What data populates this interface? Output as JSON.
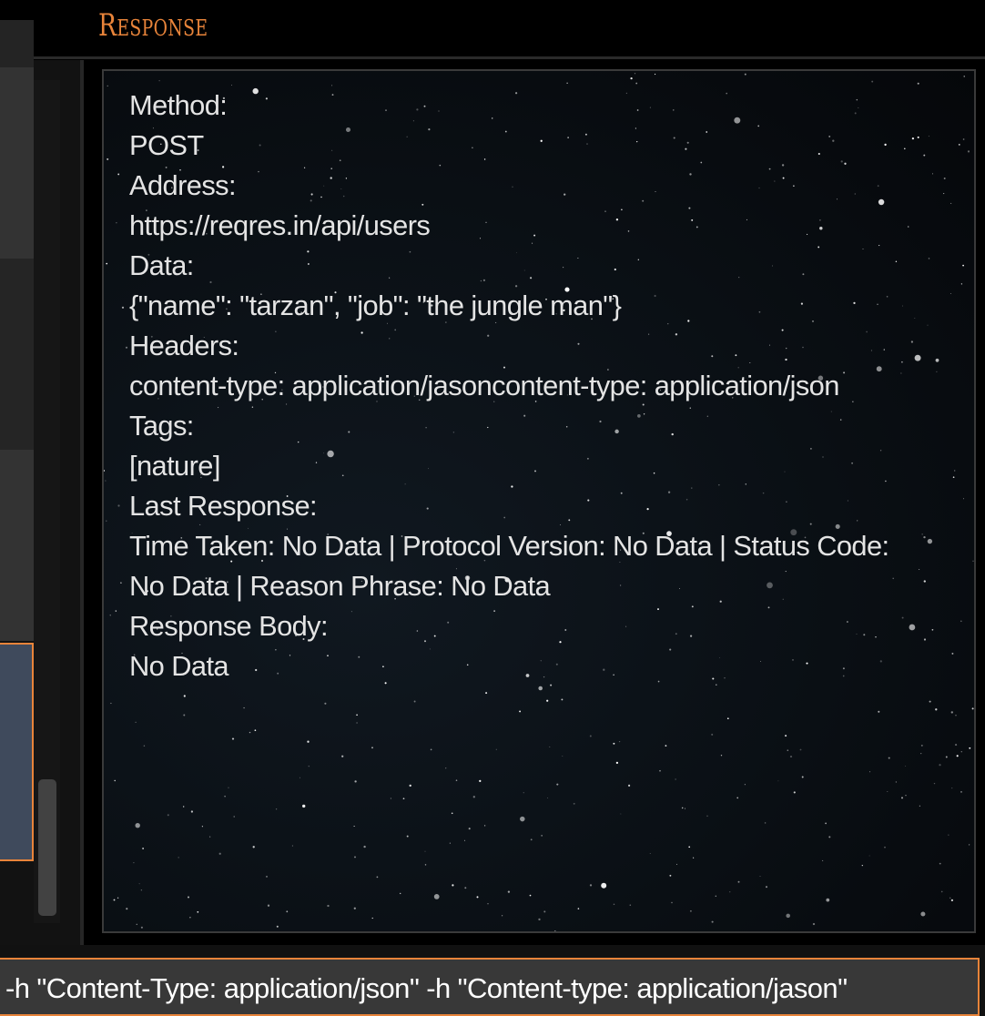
{
  "header": {
    "title": "Response"
  },
  "response": {
    "lines": [
      "Method:",
      "POST",
      "Address:",
      "https://reqres.in/api/users",
      "Data:",
      "{\"name\": \"tarzan\", \"job\": \"the jungle man\"}",
      "Headers:",
      "content-type: application/jasoncontent-type: application/json",
      "Tags:",
      "[nature]",
      "Last Response:",
      "Time Taken: No Data | Protocol Version: No Data | Status Code:",
      "No Data | Reason Phrase: No Data",
      "Response Body:",
      "No Data"
    ]
  },
  "command": {
    "value": "-h \"Content-Type: application/json\" -h \"Content-type: application/jason\""
  },
  "colors": {
    "accent": "#e8843a",
    "background": "#000000",
    "selected_item": "#3f4a5c"
  }
}
